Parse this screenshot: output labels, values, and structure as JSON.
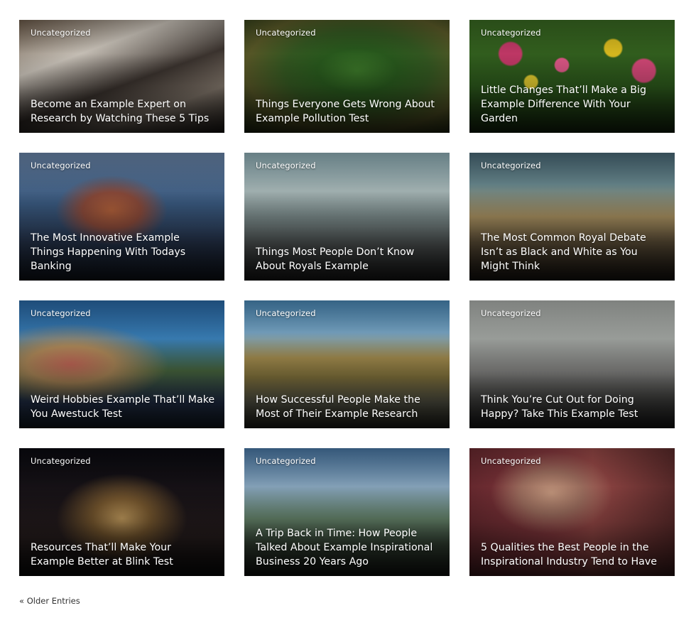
{
  "posts": [
    {
      "category": "Uncategorized",
      "title": "Become an Example Expert on Research by Watching These 5 Tips"
    },
    {
      "category": "Uncategorized",
      "title": "Things Everyone Gets Wrong About Example Pollution Test"
    },
    {
      "category": "Uncategorized",
      "title": "Little Changes That’ll Make a Big Example Difference With Your Garden"
    },
    {
      "category": "Uncategorized",
      "title": "The Most Innovative Example Things Happening With Todays Banking"
    },
    {
      "category": "Uncategorized",
      "title": "Things Most People Don’t Know About Royals Example"
    },
    {
      "category": "Uncategorized",
      "title": "The Most Common Royal Debate Isn’t as Black and White as You Might Think"
    },
    {
      "category": "Uncategorized",
      "title": "Weird Hobbies Example That’ll Make You Awestuck Test"
    },
    {
      "category": "Uncategorized",
      "title": "How Successful People Make the Most of Their Example Research"
    },
    {
      "category": "Uncategorized",
      "title": "Think You’re Cut Out for Doing Happy? Take This Example Test"
    },
    {
      "category": "Uncategorized",
      "title": "Resources That’ll Make Your Example Better at Blink Test"
    },
    {
      "category": "Uncategorized",
      "title": "A Trip Back in Time: How People Talked About Example Inspirational Business 20 Years Ago"
    },
    {
      "category": "Uncategorized",
      "title": "5 Qualities the Best People in the Inspirational Industry Tend to Have"
    }
  ],
  "pagination": {
    "older_entries": "« Older Entries"
  }
}
